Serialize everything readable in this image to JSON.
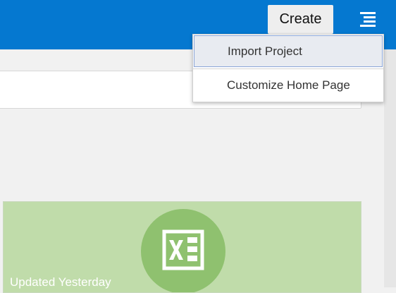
{
  "header": {
    "create_label": "Create",
    "menu_icon": "hamburger-menu-icon",
    "bar_color": "#0578d0"
  },
  "dropdown": {
    "items": [
      {
        "label": "Import Project",
        "highlighted": true
      },
      {
        "label": "Customize Home Page",
        "highlighted": false
      }
    ]
  },
  "search": {
    "value": ""
  },
  "tile": {
    "label": "Updated Yesterday",
    "icon": "excel-icon",
    "color": "#c0dcaa",
    "icon_bg": "#8fc16f"
  }
}
